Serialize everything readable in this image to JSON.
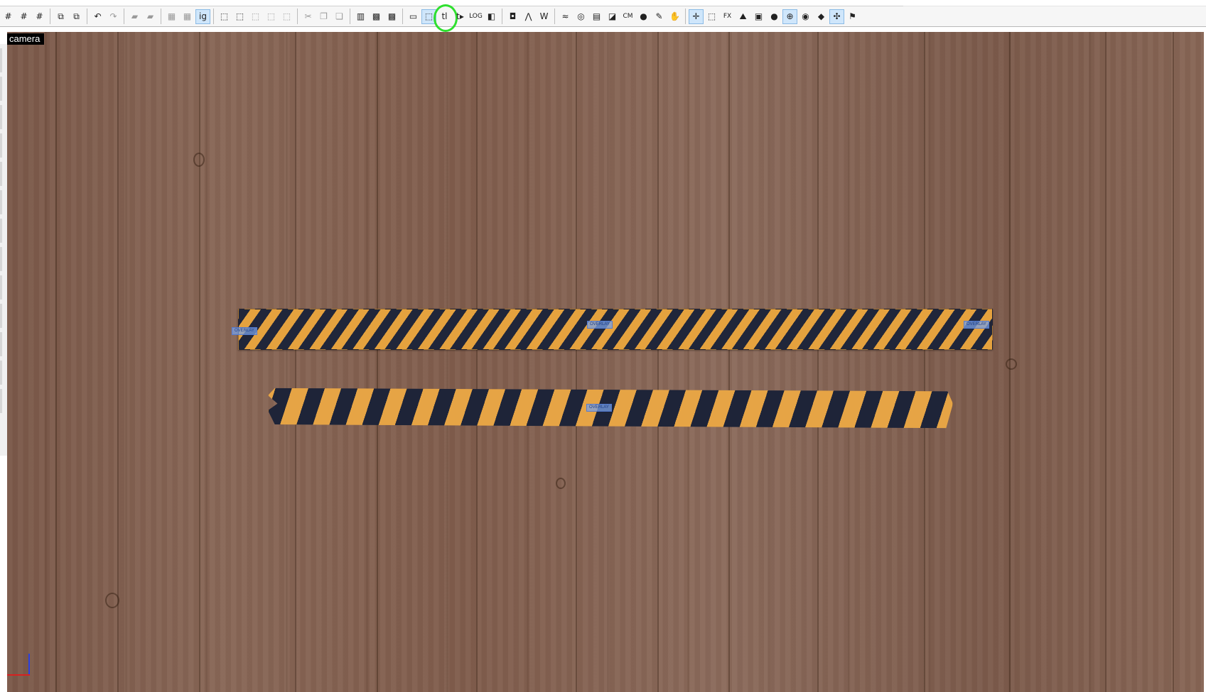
{
  "viewport": {
    "camera_label": "camera"
  },
  "toolbar": {
    "groups": [
      [
        {
          "icon": "snap-grid-icon",
          "glyph": "#"
        },
        {
          "icon": "grid-icon",
          "glyph": "#"
        },
        {
          "icon": "grid-plus-icon",
          "glyph": "#"
        }
      ],
      [
        {
          "icon": "group-icon",
          "glyph": "⧉"
        },
        {
          "icon": "ungroup-icon",
          "glyph": "⧉"
        }
      ],
      [
        {
          "icon": "undo-icon",
          "glyph": "↶"
        },
        {
          "icon": "redo-icon",
          "glyph": "↷",
          "disabled": true
        }
      ],
      [
        {
          "icon": "carve-icon",
          "glyph": "▰",
          "disabled": true
        },
        {
          "icon": "hollow-icon",
          "glyph": "▰",
          "disabled": true
        }
      ],
      [
        {
          "icon": "brush-select-icon",
          "glyph": "▦",
          "disabled": true
        },
        {
          "icon": "face-select-icon",
          "glyph": "▦",
          "disabled": true
        },
        {
          "icon": "ignore-groups-icon",
          "glyph": "ig",
          "active": true
        }
      ],
      [
        {
          "icon": "texture-lock-icon",
          "glyph": "⬚"
        },
        {
          "icon": "cube-icon",
          "glyph": "⬚"
        },
        {
          "icon": "cube-disabled-icon",
          "glyph": "⬚",
          "disabled": true
        },
        {
          "icon": "cube-wire-icon",
          "glyph": "⬚",
          "disabled": true
        },
        {
          "icon": "cube-faded-icon",
          "glyph": "⬚",
          "disabled": true
        }
      ],
      [
        {
          "icon": "cut-icon",
          "glyph": "✂",
          "disabled": true
        },
        {
          "icon": "copy-icon",
          "glyph": "❐",
          "disabled": true
        },
        {
          "icon": "paste-icon",
          "glyph": "❏",
          "disabled": true
        }
      ],
      [
        {
          "icon": "hazard-stripe-icon",
          "glyph": "▥"
        },
        {
          "icon": "hazard-x-icon",
          "glyph": "▩"
        },
        {
          "icon": "hazard-alt-icon",
          "glyph": "▩"
        }
      ],
      [
        {
          "icon": "bounding-box-icon",
          "glyph": "▭"
        },
        {
          "icon": "selection-box-icon",
          "glyph": "⬚",
          "active": true
        },
        {
          "icon": "tl-icon",
          "glyph": "tl",
          "highlighted": true
        },
        {
          "icon": "tool-arrow-icon",
          "glyph": "t▸"
        },
        {
          "icon": "logic-icon",
          "glyph": "LOG",
          "small": true
        },
        {
          "icon": "split-icon",
          "glyph": "◧"
        }
      ],
      [
        {
          "icon": "displacement-icon",
          "glyph": "◘"
        },
        {
          "icon": "path-icon",
          "glyph": "⋀"
        },
        {
          "icon": "wire-icon",
          "glyph": "W"
        }
      ],
      [
        {
          "icon": "overlay-icon",
          "glyph": "≈"
        },
        {
          "icon": "globe-icon",
          "glyph": "◎"
        },
        {
          "icon": "film-icon",
          "glyph": "▤"
        },
        {
          "icon": "cubes-icon",
          "glyph": "◪"
        },
        {
          "icon": "cm-icon",
          "glyph": "CM",
          "small": true
        },
        {
          "icon": "leaf-icon",
          "glyph": "●"
        },
        {
          "icon": "draw-icon",
          "glyph": "✎"
        },
        {
          "icon": "hand-icon",
          "glyph": "✋"
        }
      ],
      [
        {
          "icon": "fx-move-icon",
          "glyph": "✛",
          "active": true
        },
        {
          "icon": "dotted-select-icon",
          "glyph": "⬚"
        },
        {
          "icon": "fx-icon",
          "glyph": "FX",
          "small": true
        },
        {
          "icon": "terrain-icon",
          "glyph": "⛰"
        },
        {
          "icon": "prop-icon",
          "glyph": "▣"
        },
        {
          "icon": "node-icon",
          "glyph": "●"
        },
        {
          "icon": "target-icon",
          "glyph": "⊕",
          "active": true
        },
        {
          "icon": "light-icon",
          "glyph": "◉"
        },
        {
          "icon": "shapes-icon",
          "glyph": "◆"
        },
        {
          "icon": "align-icon",
          "glyph": "✣",
          "active": true
        },
        {
          "icon": "flag-icon",
          "glyph": "⚑"
        }
      ]
    ]
  },
  "tapes": [
    {
      "tags": [
        "OVERLAY",
        "OVERLAY",
        "OVERLAY"
      ]
    },
    {
      "tags": [
        "OVERLAY"
      ]
    }
  ]
}
